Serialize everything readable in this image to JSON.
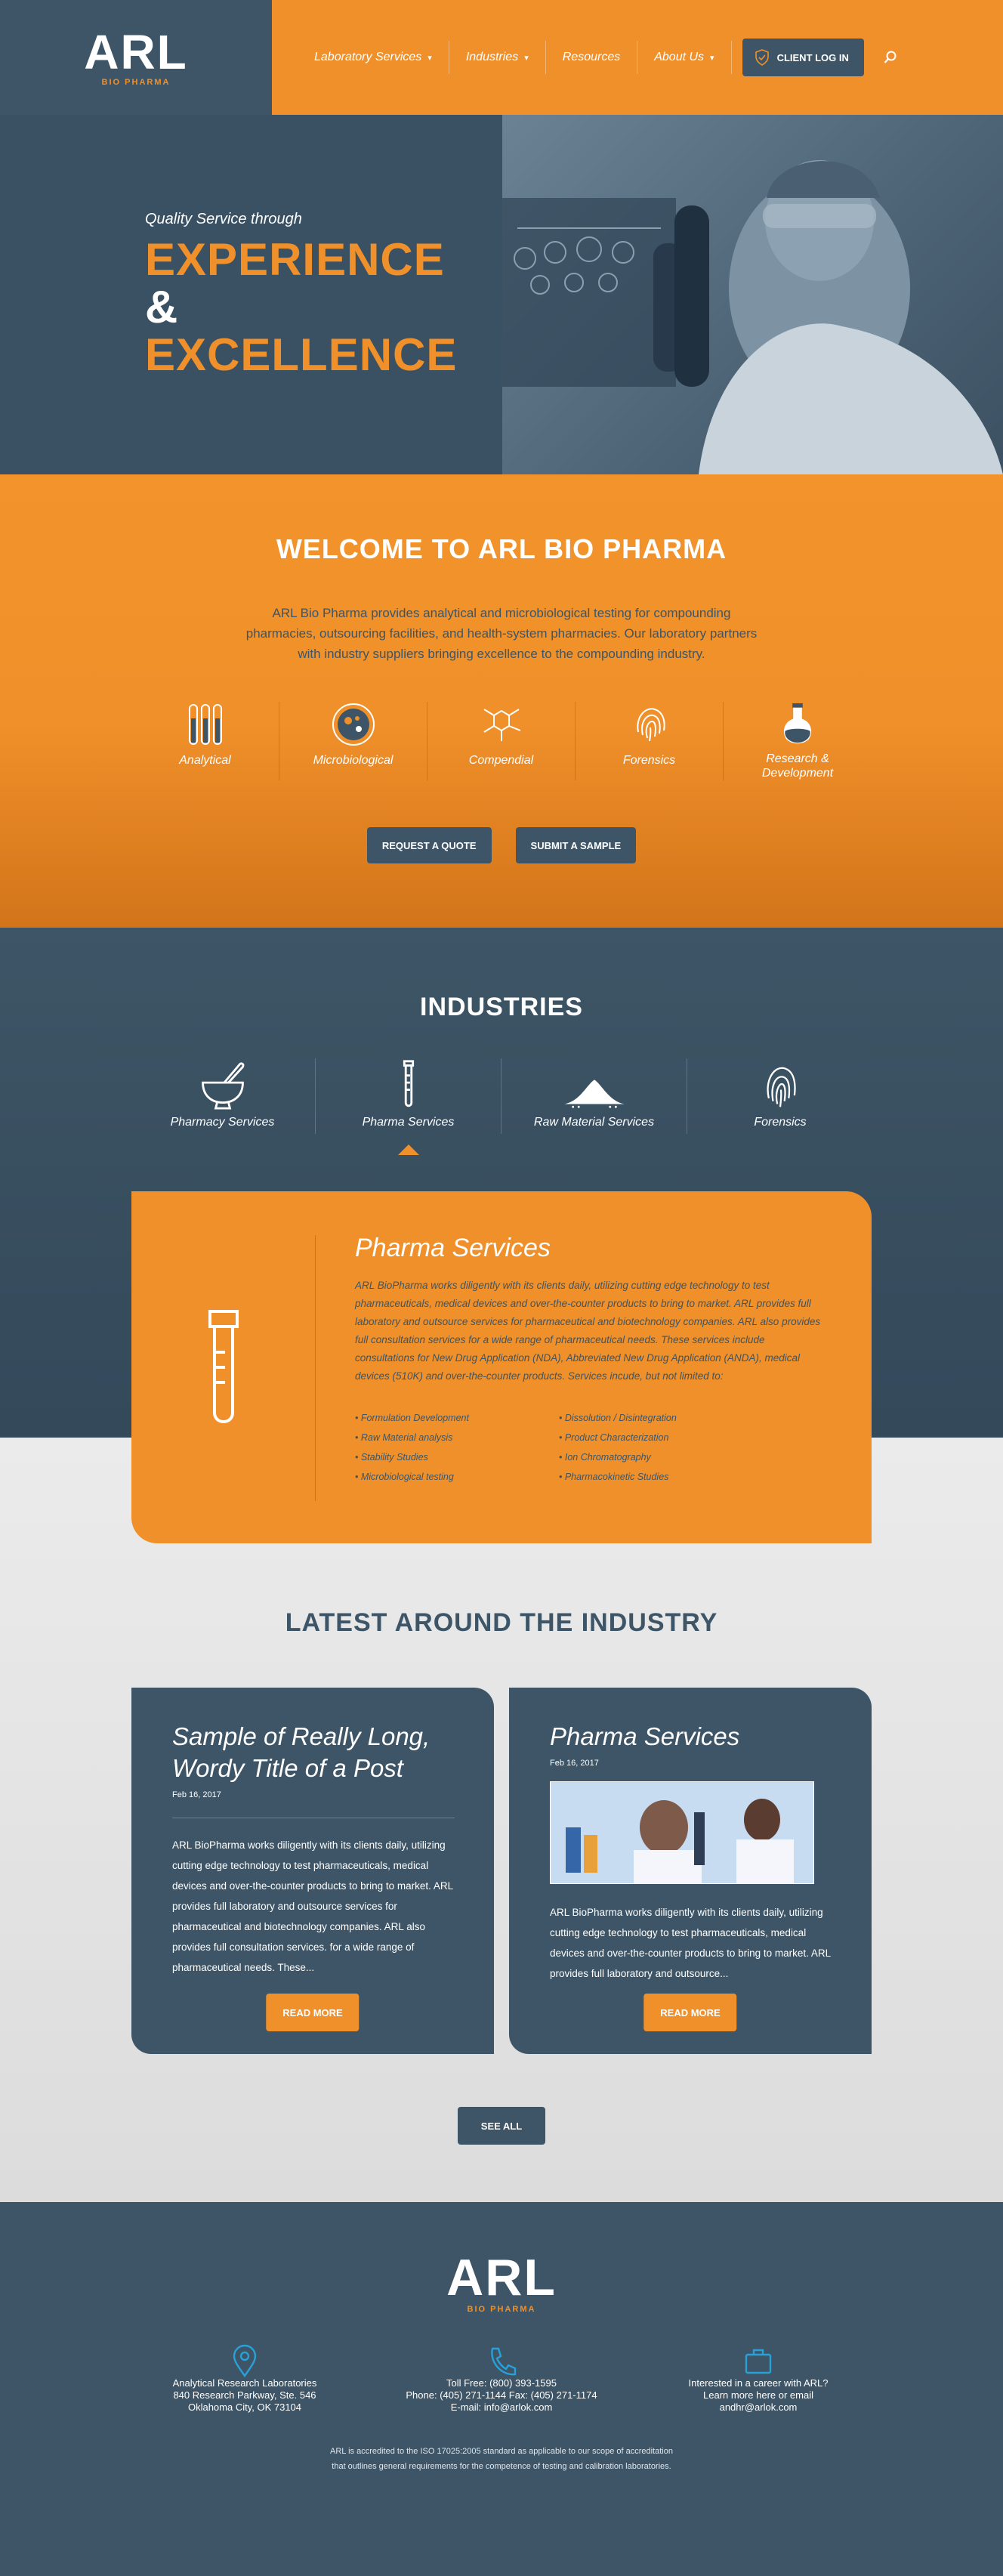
{
  "brand": {
    "name": "ARL",
    "sub": "BIO PHARMA",
    "accent": "#f0902a",
    "primary": "#3d5566"
  },
  "nav": {
    "items": [
      "Laboratory Services",
      "Industries",
      "Resources",
      "About Us"
    ],
    "client_login": "CLIENT LOG IN"
  },
  "hero": {
    "pre": "Quality Service through",
    "line1": "EXPERIENCE",
    "amp": "&",
    "line2": "EXCELLENCE"
  },
  "welcome": {
    "title": "WELCOME TO ARL BIO PHARMA",
    "body": "ARL Bio Pharma provides analytical and microbiological testing for compounding pharmacies, outsourcing facilities, and health-system pharmacies. Our laboratory partners with industry suppliers bringing excellence to the compounding industry.",
    "services": [
      {
        "label": "Analytical",
        "icon": "test-tubes-icon"
      },
      {
        "label": "Microbiological",
        "icon": "petri-dish-icon"
      },
      {
        "label": "Compendial",
        "icon": "molecule-icon"
      },
      {
        "label": "Forensics",
        "icon": "fingerprint-icon"
      },
      {
        "label": "Research &\nDevelopment",
        "icon": "flask-icon"
      }
    ],
    "cta_quote": "REQUEST A QUOTE",
    "cta_sample": "SUBMIT A SAMPLE"
  },
  "industries": {
    "title": "INDUSTRIES",
    "tabs": [
      {
        "label": "Pharmacy Services",
        "icon": "mortar-pestle-icon"
      },
      {
        "label": "Pharma Services",
        "icon": "test-tube-icon"
      },
      {
        "label": "Raw Material Services",
        "icon": "powder-pile-icon"
      },
      {
        "label": "Forensics",
        "icon": "fingerprint-icon"
      }
    ],
    "active_tab": "Pharma Services",
    "panel": {
      "title": "Pharma Services",
      "body": "ARL BioPharma works diligently with its clients daily, utilizing cutting edge technology to test pharmaceuticals, medical devices and over-the-counter products to bring to market. ARL provides full laboratory and outsource services for pharmaceutical and biotechnology companies. ARL also provides full consultation services for a wide range of pharmaceutical needs. These services include consultations for New Drug Application (NDA), Abbreviated New Drug Application (ANDA), medical devices (510K) and over-the-counter products. Services incude, but not limited to:",
      "list_left": [
        "• Formulation Development",
        "• Raw Material analysis",
        "• Stability Studies",
        "• Microbiological testing"
      ],
      "list_right": [
        "• Dissolution / Disintegration",
        "• Product Characterization",
        "• Ion Chromatography",
        "• Pharmacokinetic Studies"
      ]
    }
  },
  "latest": {
    "title": "LATEST AROUND THE INDUSTRY",
    "posts": [
      {
        "title": "Sample of Really Long, Wordy Title of a Post",
        "date": "Feb 16, 2017",
        "excerpt": "ARL BioPharma works diligently with its clients daily, utilizing cutting edge technology to test pharmaceuticals, medical devices and over-the-counter products to bring to market. ARL provides full laboratory and outsource services for pharmaceutical and biotechnology companies. ARL also provides full consultation services. for a wide range of pharmaceutical needs. These...",
        "cta": "READ MORE"
      },
      {
        "title": "Pharma Services",
        "date": "Feb 16, 2017",
        "excerpt": "ARL BioPharma works diligently with its clients daily, utilizing cutting edge technology to test pharmaceuticals, medical devices and over-the-counter products to bring to market. ARL provides full laboratory and outsource...",
        "cta": "READ MORE"
      }
    ],
    "see_all": "SEE ALL"
  },
  "footer": {
    "address": [
      "Analytical Research Laboratories",
      "840 Research Parkway, Ste. 546",
      "Oklahoma City, OK 73104"
    ],
    "phone": [
      "Toll Free: (800) 393-1595",
      "Phone: (405) 271-1144 Fax: (405) 271-1174",
      "E-mail: info@arlok.com"
    ],
    "career": [
      "Interested in a career with ARL?",
      "Learn more here or email",
      "andhr@arlok.com"
    ],
    "note": [
      "ARL is accredited to the ISO 17025:2005 standard as applicable to our scope of accreditation",
      "that outlines general requirements for the competence of testing and calibration laboratories."
    ]
  }
}
